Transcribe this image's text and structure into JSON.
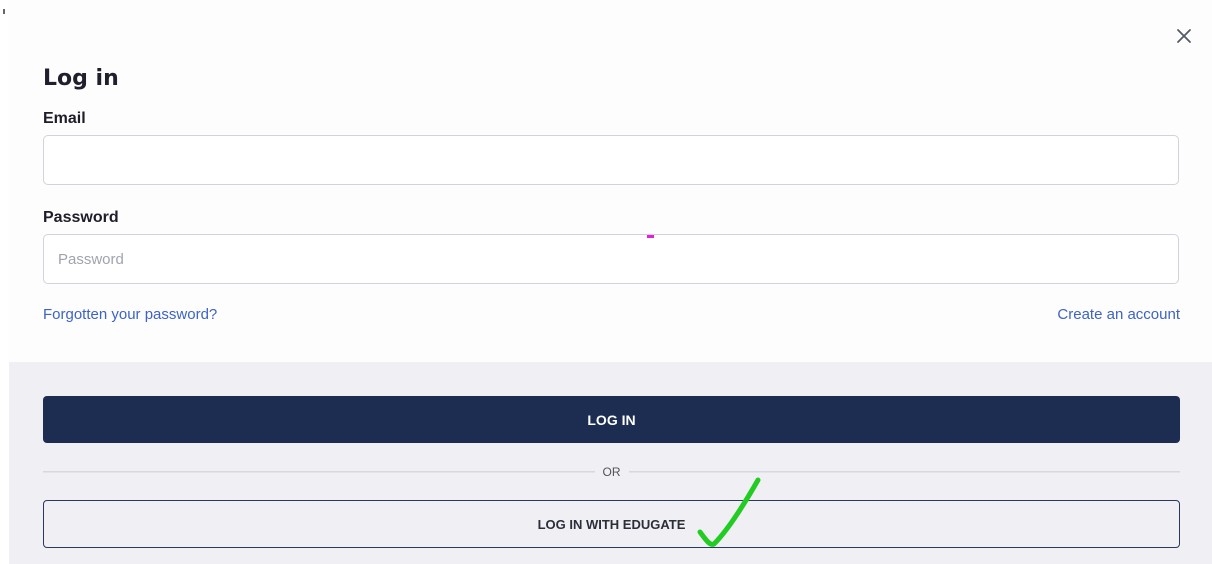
{
  "dialog": {
    "title": "Log in",
    "close_icon": "close-icon"
  },
  "form": {
    "email": {
      "label": "Email",
      "value": "",
      "placeholder": ""
    },
    "password": {
      "label": "Password",
      "value": "",
      "placeholder": "Password"
    },
    "forgot_link": "Forgotten your password?",
    "create_link": "Create an account"
  },
  "actions": {
    "login_label": "LOG IN",
    "or_label": "OR",
    "edugate_label": "LOG IN WITH EDUGATE"
  },
  "colors": {
    "primary": "#1d2d52",
    "link": "#3d63c4",
    "footer_bg": "#efeff4",
    "annotation_check": "#22cc22"
  }
}
